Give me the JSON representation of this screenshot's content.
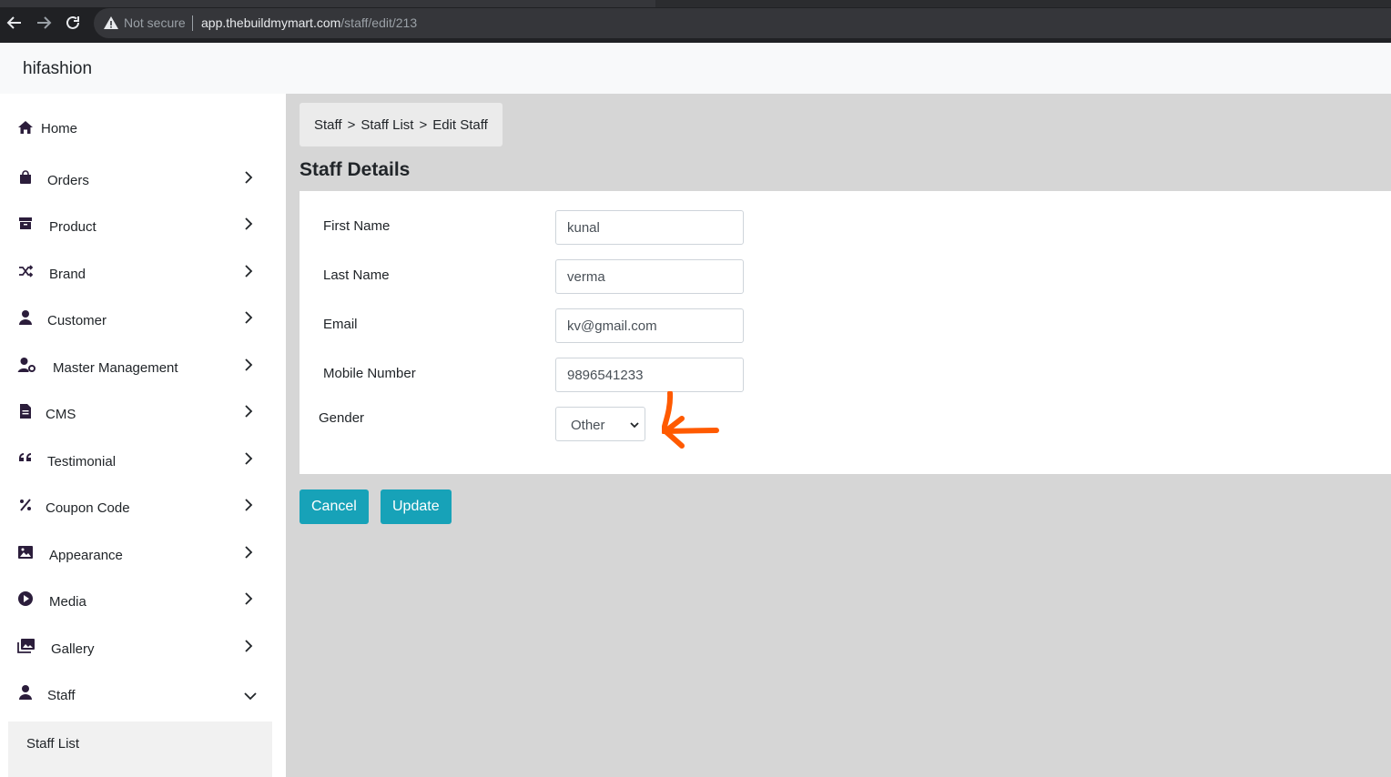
{
  "browser": {
    "security_label": "Not secure",
    "url_host": "app.thebuildmymart.com",
    "url_path": "/staff/edit/213"
  },
  "app": {
    "brand": "hifashion"
  },
  "sidebar": {
    "items": [
      {
        "label": "Home",
        "icon": "home-icon"
      },
      {
        "label": "Orders",
        "icon": "shopping-bag-icon"
      },
      {
        "label": "Product",
        "icon": "archive-icon"
      },
      {
        "label": "Brand",
        "icon": "shuffle-icon"
      },
      {
        "label": "Customer",
        "icon": "user-icon"
      },
      {
        "label": "Master Management",
        "icon": "user-gear-icon"
      },
      {
        "label": "CMS",
        "icon": "file-icon"
      },
      {
        "label": "Testimonial",
        "icon": "quote-icon"
      },
      {
        "label": "Coupon Code",
        "icon": "percent-icon"
      },
      {
        "label": "Appearance",
        "icon": "image-icon"
      },
      {
        "label": "Media",
        "icon": "play-circle-icon"
      },
      {
        "label": "Gallery",
        "icon": "images-icon"
      },
      {
        "label": "Staff",
        "icon": "user-icon"
      }
    ],
    "sub_items": [
      {
        "label": "Staff List"
      }
    ]
  },
  "breadcrumb": [
    "Staff",
    "Staff List",
    "Edit Staff"
  ],
  "breadcrumb_separator": ">",
  "page": {
    "title": "Staff Details"
  },
  "form": {
    "first_name": {
      "label": "First Name",
      "value": "kunal"
    },
    "last_name": {
      "label": "Last Name",
      "value": "verma"
    },
    "email": {
      "label": "Email",
      "value": "kv@gmail.com"
    },
    "mobile": {
      "label": "Mobile Number",
      "value": "9896541233"
    },
    "gender": {
      "label": "Gender",
      "selected": "Other"
    }
  },
  "buttons": {
    "cancel": "Cancel",
    "update": "Update"
  },
  "colors": {
    "accent": "#17a2b8",
    "annotation": "#ff5a00",
    "sidebar_icon": "#2b1d3b"
  }
}
